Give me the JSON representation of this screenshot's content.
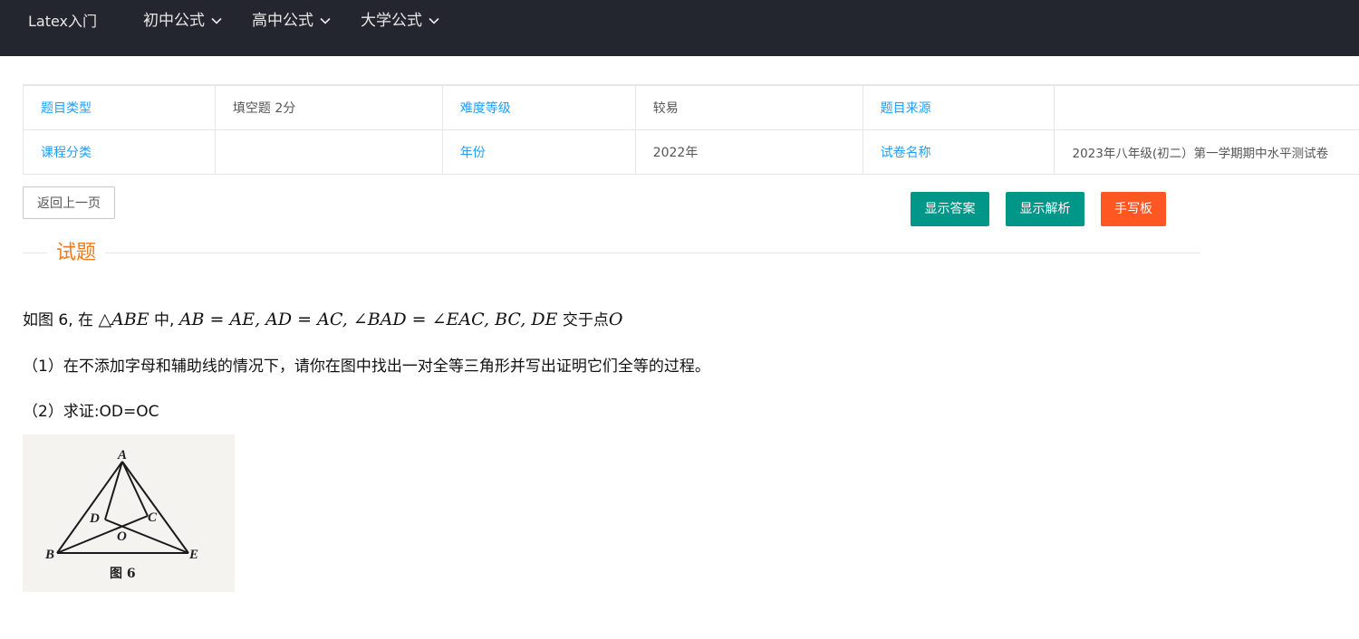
{
  "navbar": {
    "brand": "Latex入门",
    "menus": [
      {
        "label": "初中公式"
      },
      {
        "label": "高中公式"
      },
      {
        "label": "大学公式"
      }
    ]
  },
  "info_table": {
    "row1": {
      "type_label": "题目类型",
      "type_value": "填空题 2分",
      "difficulty_label": "难度等级",
      "difficulty_value": "较易",
      "source_label": "题目来源",
      "source_value": ""
    },
    "row2": {
      "course_label": "课程分类",
      "course_value": "",
      "year_label": "年份",
      "year_value": "2022年",
      "paper_label": "试卷名称",
      "paper_value": "2023年八年级(初二）第一学期期中水平测试卷"
    }
  },
  "buttons": {
    "back": "返回上一页",
    "show_answer": "显示答案",
    "show_analysis": "显示解析",
    "handwriting": "手写板"
  },
  "section": {
    "title": "试题"
  },
  "question": {
    "line1_prefix": "如图 6, 在 ",
    "triangle": "△ABE",
    "mid1": " 中, ",
    "conditions": "AB = AE, AD = AC, ∠BAD = ∠EAC, BC, DE",
    "suffix_text": " 交于点",
    "point": "O",
    "part1": "（1）在不添加字母和辅助线的情况下，请你在图中找出一对全等三角形并写出证明它们全等的过程。",
    "part2": "（2）求证:OD=OC"
  },
  "figure": {
    "points": [
      "A",
      "B",
      "E",
      "D",
      "C",
      "O"
    ],
    "caption": "图 6"
  }
}
